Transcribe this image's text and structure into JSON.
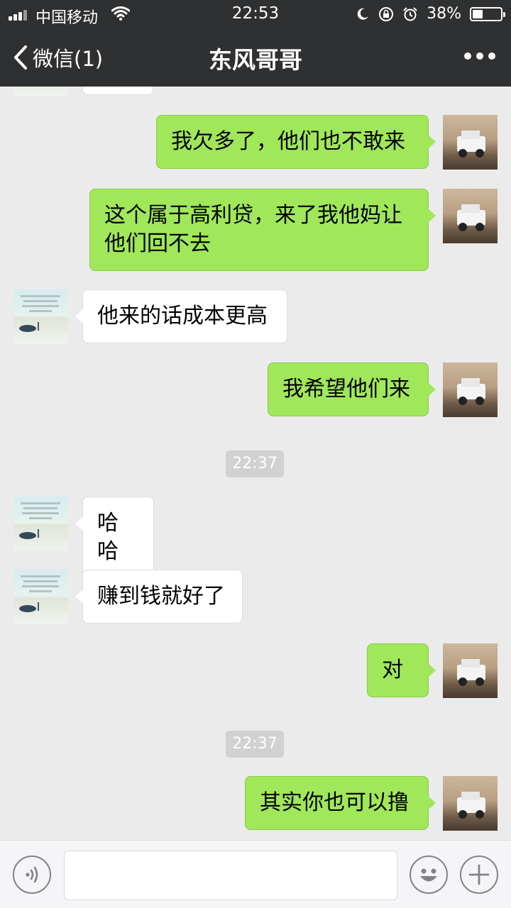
{
  "status_bar": {
    "carrier": "中国移动",
    "time": "22:53",
    "battery_percent_text": "38%",
    "battery_level": 0.38
  },
  "nav": {
    "back_label": "微信(1)",
    "title": "东风哥哥"
  },
  "messages": [
    {
      "side": "mine",
      "text": "我欠多了，他们也不敢来"
    },
    {
      "side": "mine",
      "text": "这个属于高利贷，来了我他妈让他们回不去"
    },
    {
      "side": "theirs",
      "text": "他来的话成本更高"
    },
    {
      "side": "mine",
      "text": "我希望他们来"
    },
    {
      "side": "time",
      "text": "22:37"
    },
    {
      "side": "theirs",
      "text": "哈哈"
    },
    {
      "side": "theirs",
      "text": "赚到钱就好了"
    },
    {
      "side": "mine",
      "text": "对"
    },
    {
      "side": "time",
      "text": "22:37"
    },
    {
      "side": "mine",
      "text": "其实你也可以撸"
    }
  ],
  "input_bar": {
    "placeholder": ""
  },
  "colors": {
    "nav_background": "#2f3031",
    "chat_background": "#ebebeb",
    "my_bubble": "#a0e75a",
    "their_bubble": "#ffffff",
    "timestamp_pill": "#d1d1d1"
  },
  "icons": {
    "back": "chevron-left-icon",
    "more": "more-dots-icon",
    "voice": "voice-icon",
    "emoji": "emoji-icon",
    "plus": "plus-icon"
  }
}
